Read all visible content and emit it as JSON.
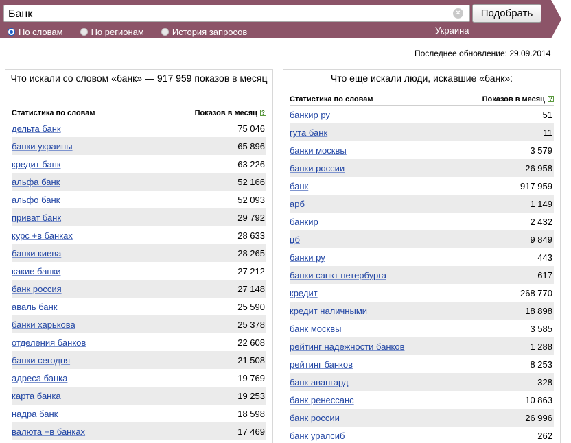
{
  "search": {
    "query": "Банк",
    "clear_label": "×",
    "submit_label": "Подобрать"
  },
  "modes": [
    {
      "label": "По словам",
      "selected": true
    },
    {
      "label": "По регионам",
      "selected": false
    },
    {
      "label": "История запросов",
      "selected": false
    }
  ],
  "region": "Украина",
  "updated": "Последнее обновление: 29.09.2014",
  "left_panel": {
    "title": "Что искали со словом «банк» — 917 959 показов в месяц",
    "col_phrase": "Статистика по словам",
    "col_count": "Показов в месяц",
    "help": "?",
    "rows": [
      {
        "phrase": "дельта банк",
        "count": "75 046"
      },
      {
        "phrase": "банки украины",
        "count": "65 896"
      },
      {
        "phrase": "кредит банк",
        "count": "63 226"
      },
      {
        "phrase": "альфа банк",
        "count": "52 166"
      },
      {
        "phrase": "альфо банк",
        "count": "52 093"
      },
      {
        "phrase": "приват банк",
        "count": "29 792"
      },
      {
        "phrase": "курс +в банках",
        "count": "28 633"
      },
      {
        "phrase": "банки киева",
        "count": "28 265"
      },
      {
        "phrase": "какие банки",
        "count": "27 212"
      },
      {
        "phrase": "банк россия",
        "count": "27 148"
      },
      {
        "phrase": "аваль банк",
        "count": "25 590"
      },
      {
        "phrase": "банки харькова",
        "count": "25 378"
      },
      {
        "phrase": "отделения банков",
        "count": "22 608"
      },
      {
        "phrase": "банки сегодня",
        "count": "21 508"
      },
      {
        "phrase": "адреса банка",
        "count": "19 769"
      },
      {
        "phrase": "карта банка",
        "count": "19 253"
      },
      {
        "phrase": "надра банк",
        "count": "18 598"
      },
      {
        "phrase": "валюта +в банках",
        "count": "17 469"
      }
    ]
  },
  "right_panel": {
    "title": "Что еще искали люди, искавшие «банк»:",
    "col_phrase": "Статистика по словам",
    "col_count": "Показов в месяц",
    "help": "?",
    "rows": [
      {
        "phrase": "банкир ру",
        "count": "51"
      },
      {
        "phrase": "гута банк",
        "count": "11"
      },
      {
        "phrase": "банки москвы",
        "count": "3 579"
      },
      {
        "phrase": "банки россии",
        "count": "26 958"
      },
      {
        "phrase": "банк",
        "count": "917 959"
      },
      {
        "phrase": "арб",
        "count": "1 149"
      },
      {
        "phrase": "банкир",
        "count": "2 432"
      },
      {
        "phrase": "цб",
        "count": "9 849"
      },
      {
        "phrase": "банки ру",
        "count": "443"
      },
      {
        "phrase": "банки санкт петербурга",
        "count": "617"
      },
      {
        "phrase": "кредит",
        "count": "268 770"
      },
      {
        "phrase": "кредит наличными",
        "count": "18 898"
      },
      {
        "phrase": "банк москвы",
        "count": "3 585"
      },
      {
        "phrase": "рейтинг надежности банков",
        "count": "1 288"
      },
      {
        "phrase": "рейтинг банков",
        "count": "8 253"
      },
      {
        "phrase": "банк авангард",
        "count": "328"
      },
      {
        "phrase": "банк ренессанс",
        "count": "10 863"
      },
      {
        "phrase": "банк россии",
        "count": "26 996"
      },
      {
        "phrase": "банк уралсиб",
        "count": "262"
      }
    ]
  },
  "colors": {
    "bar": "#8c5468",
    "link": "#2246a4",
    "row_alt": "#ebebeb"
  }
}
